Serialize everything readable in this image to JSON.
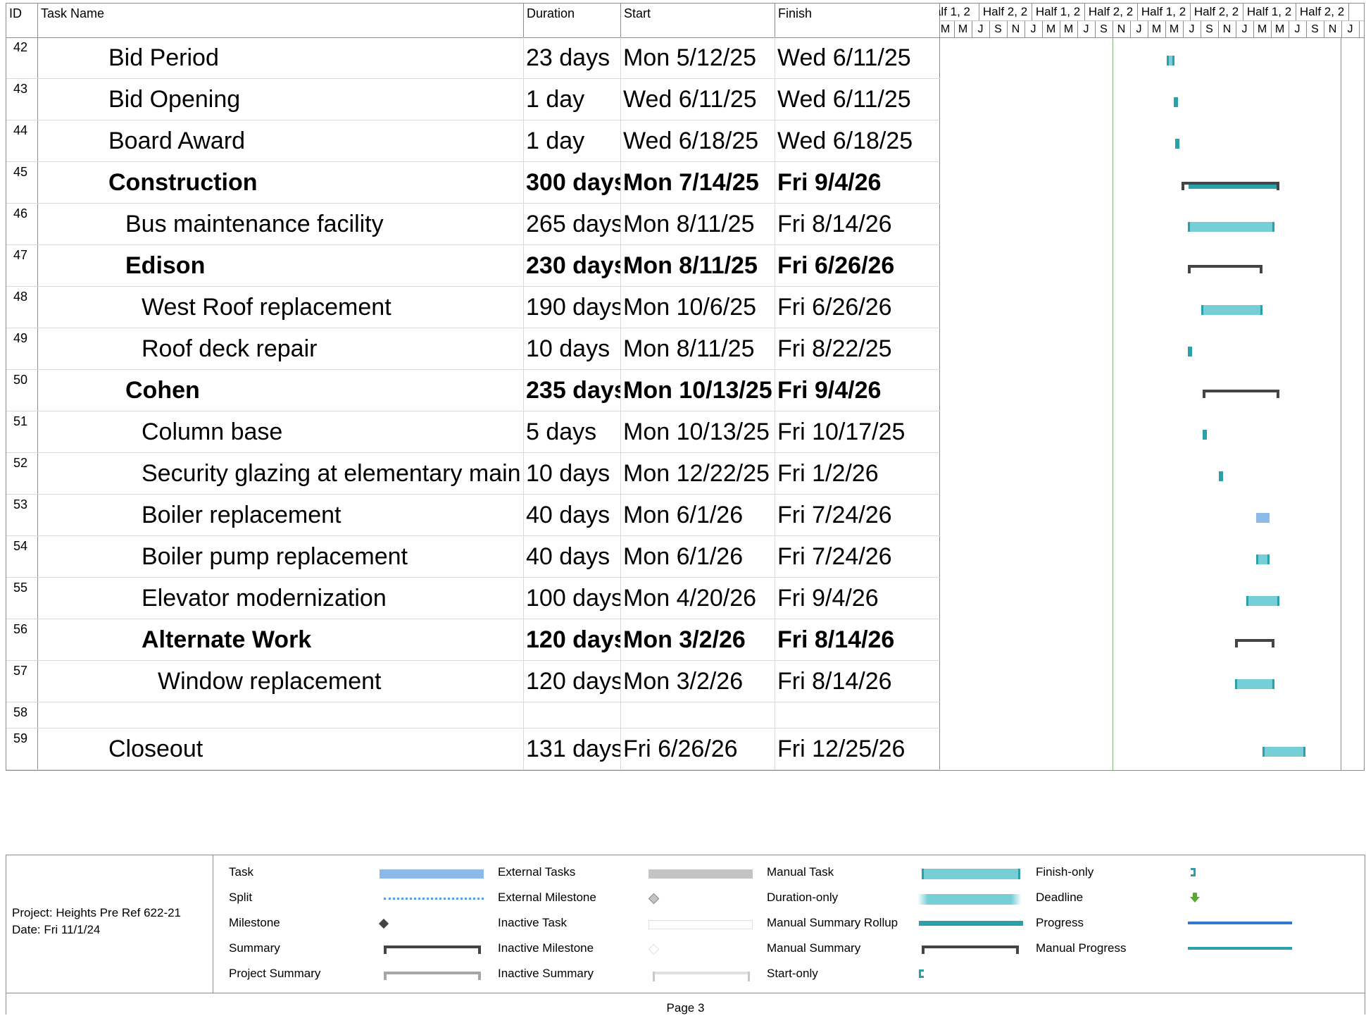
{
  "table": {
    "headers": {
      "id": "ID",
      "name": "Task Name",
      "duration": "Duration",
      "start": "Start",
      "finish": "Finish"
    },
    "rows": [
      {
        "id": "42",
        "name": "Bid Period",
        "duration": "23 days",
        "start": "Mon 5/12/25",
        "finish": "Wed 6/11/25",
        "level": 0,
        "bold": false
      },
      {
        "id": "43",
        "name": "Bid Opening",
        "duration": "1 day",
        "start": "Wed 6/11/25",
        "finish": "Wed 6/11/25",
        "level": 0,
        "bold": false
      },
      {
        "id": "44",
        "name": "Board Award",
        "duration": "1 day",
        "start": "Wed 6/18/25",
        "finish": "Wed 6/18/25",
        "level": 0,
        "bold": false
      },
      {
        "id": "45",
        "name": "Construction",
        "duration": "300 days",
        "start": "Mon 7/14/25",
        "finish": "Fri 9/4/26",
        "level": 0,
        "bold": true
      },
      {
        "id": "46",
        "name": "Bus maintenance facility",
        "duration": "265 days",
        "start": "Mon 8/11/25",
        "finish": "Fri 8/14/26",
        "level": 1,
        "bold": false
      },
      {
        "id": "47",
        "name": "Edison",
        "duration": "230 days",
        "start": "Mon 8/11/25",
        "finish": "Fri 6/26/26",
        "level": 1,
        "bold": true
      },
      {
        "id": "48",
        "name": "West Roof replacement",
        "duration": "190 days",
        "start": "Mon 10/6/25",
        "finish": "Fri 6/26/26",
        "level": 2,
        "bold": false
      },
      {
        "id": "49",
        "name": "Roof deck repair",
        "duration": "10 days",
        "start": "Mon 8/11/25",
        "finish": "Fri 8/22/25",
        "level": 2,
        "bold": false
      },
      {
        "id": "50",
        "name": "Cohen",
        "duration": "235 days",
        "start": "Mon 10/13/25",
        "finish": "Fri 9/4/26",
        "level": 1,
        "bold": true
      },
      {
        "id": "51",
        "name": "Column base",
        "duration": "5 days",
        "start": "Mon 10/13/25",
        "finish": "Fri 10/17/25",
        "level": 2,
        "bold": false
      },
      {
        "id": "52",
        "name": "Security glazing at elementary main entrances",
        "duration": "10 days",
        "start": "Mon 12/22/25",
        "finish": "Fri 1/2/26",
        "level": 2,
        "bold": false
      },
      {
        "id": "53",
        "name": "Boiler replacement",
        "duration": "40 days",
        "start": "Mon 6/1/26",
        "finish": "Fri 7/24/26",
        "level": 2,
        "bold": false
      },
      {
        "id": "54",
        "name": "Boiler pump replacement",
        "duration": "40 days",
        "start": "Mon 6/1/26",
        "finish": "Fri 7/24/26",
        "level": 2,
        "bold": false
      },
      {
        "id": "55",
        "name": "Elevator modernization",
        "duration": "100 days",
        "start": "Mon 4/20/26",
        "finish": "Fri 9/4/26",
        "level": 2,
        "bold": false
      },
      {
        "id": "56",
        "name": "Alternate Work",
        "duration": "120 days",
        "start": "Mon 3/2/26",
        "finish": "Fri 8/14/26",
        "level": 2,
        "bold": true
      },
      {
        "id": "57",
        "name": "Window replacement",
        "duration": "120 days",
        "start": "Mon 3/2/26",
        "finish": "Fri 8/14/26",
        "level": 3,
        "bold": false
      },
      {
        "id": "58",
        "name": "",
        "duration": "",
        "start": "",
        "finish": "",
        "level": 0,
        "bold": false
      },
      {
        "id": "59",
        "name": "Closeout",
        "duration": "131 days",
        "start": "Fri 6/26/26",
        "finish": "Fri 12/25/26",
        "level": 0,
        "bold": false
      }
    ]
  },
  "timescale": {
    "top_tier": [
      "alf 1, 2",
      "Half 2, 2",
      "Half 1, 2",
      "Half 2, 2",
      "Half 1, 2",
      "Half 2, 2",
      "Half 1, 2",
      "Half 2, 2",
      "Hal"
    ],
    "bottom_tier": [
      "M",
      "M",
      "J",
      "S",
      "N",
      "J",
      "M",
      "M",
      "J",
      "S",
      "N",
      "J",
      "M",
      "M",
      "J",
      "S",
      "N",
      "J",
      "M",
      "M",
      "J",
      "S",
      "N",
      "J",
      "M"
    ]
  },
  "gantt_bars": [
    {
      "row": 0,
      "kind": "manual",
      "start": "2025-05-12",
      "finish": "2025-06-11"
    },
    {
      "row": 1,
      "kind": "manual",
      "start": "2025-06-11",
      "finish": "2025-06-11"
    },
    {
      "row": 2,
      "kind": "manual",
      "start": "2025-06-18",
      "finish": "2025-06-18"
    },
    {
      "row": 3,
      "kind": "summary",
      "start": "2025-07-14",
      "finish": "2026-09-04"
    },
    {
      "row": 4,
      "kind": "manual",
      "start": "2025-08-11",
      "finish": "2026-08-14"
    },
    {
      "row": 5,
      "kind": "summary",
      "start": "2025-08-11",
      "finish": "2026-06-26"
    },
    {
      "row": 6,
      "kind": "manual",
      "start": "2025-10-06",
      "finish": "2026-06-26"
    },
    {
      "row": 7,
      "kind": "manual",
      "start": "2025-08-11",
      "finish": "2025-08-22"
    },
    {
      "row": 8,
      "kind": "summary",
      "start": "2025-10-13",
      "finish": "2026-09-04"
    },
    {
      "row": 9,
      "kind": "manual",
      "start": "2025-10-13",
      "finish": "2025-10-17"
    },
    {
      "row": 10,
      "kind": "manual",
      "start": "2025-12-22",
      "finish": "2026-01-02"
    },
    {
      "row": 11,
      "kind": "task",
      "start": "2026-06-01",
      "finish": "2026-07-24"
    },
    {
      "row": 12,
      "kind": "manual",
      "start": "2026-06-01",
      "finish": "2026-07-24"
    },
    {
      "row": 13,
      "kind": "manual",
      "start": "2026-04-20",
      "finish": "2026-09-04"
    },
    {
      "row": 14,
      "kind": "summary",
      "start": "2026-03-02",
      "finish": "2026-08-14"
    },
    {
      "row": 15,
      "kind": "manual",
      "start": "2026-03-02",
      "finish": "2026-08-14"
    },
    {
      "row": 17,
      "kind": "manual",
      "start": "2026-06-26",
      "finish": "2026-12-25"
    }
  ],
  "colors": {
    "manual_task": "#76cfd6",
    "manual_task_edge": "#2aa1a8",
    "task": "#8db9e8",
    "summary": "#444444",
    "deadline": "#5aa832",
    "progress": "#2e78d2",
    "status_line": "#7ab87a"
  },
  "legend": {
    "project": "Project: Heights Pre Ref 622-21",
    "date": "Date: Fri 11/1/24",
    "items": [
      {
        "label": "Task",
        "symbol": "task-bar"
      },
      {
        "label": "Split",
        "symbol": "split-dots"
      },
      {
        "label": "Milestone",
        "symbol": "milestone-diamond"
      },
      {
        "label": "Summary",
        "symbol": "summary-bracket"
      },
      {
        "label": "Project Summary",
        "symbol": "project-summary-bracket"
      },
      {
        "label": "External Tasks",
        "symbol": "external-task-bar"
      },
      {
        "label": "External Milestone",
        "symbol": "external-milestone-diamond"
      },
      {
        "label": "Inactive Task",
        "symbol": "inactive-task-bar"
      },
      {
        "label": "Inactive Milestone",
        "symbol": "inactive-milestone-diamond"
      },
      {
        "label": "Inactive Summary",
        "symbol": "inactive-summary-bracket"
      },
      {
        "label": "Manual Task",
        "symbol": "manual-task-bar"
      },
      {
        "label": "Duration-only",
        "symbol": "duration-only-bar"
      },
      {
        "label": "Manual Summary Rollup",
        "symbol": "manual-summary-rollup-bar"
      },
      {
        "label": "Manual Summary",
        "symbol": "manual-summary-bracket"
      },
      {
        "label": "Start-only",
        "symbol": "start-only-bracket"
      },
      {
        "label": "Finish-only",
        "symbol": "finish-only-bracket"
      },
      {
        "label": "Deadline",
        "symbol": "deadline-arrow"
      },
      {
        "label": "Progress",
        "symbol": "progress-line"
      },
      {
        "label": "Manual Progress",
        "symbol": "manual-progress-line"
      }
    ]
  },
  "footer": {
    "page": "Page 3"
  }
}
